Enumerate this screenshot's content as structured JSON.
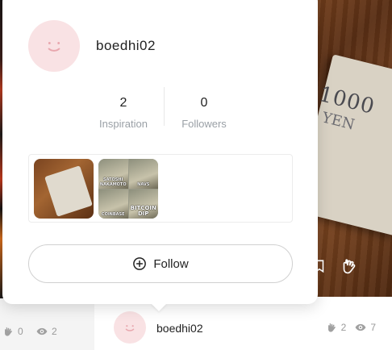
{
  "background": {
    "left_stats": {
      "likes": "0",
      "views": "2"
    },
    "author": {
      "name": "boedhi02",
      "likes": "2",
      "views": "7"
    },
    "photo_text": {
      "line1": "1000",
      "line2": "YEN"
    }
  },
  "popover": {
    "username": "boedhi02",
    "stats": [
      {
        "value": "2",
        "label": "Inspiration"
      },
      {
        "value": "0",
        "label": "Followers"
      }
    ],
    "meme_captions": [
      "SATOSHI NAKAMOTO",
      "NAVS",
      "COINBASE",
      "BITCOIN DIP"
    ],
    "follow_label": "Follow"
  },
  "colors": {
    "avatar_bg": "#f9e2e4",
    "avatar_face": "#e8a7ae",
    "muted": "#9aa0a6"
  }
}
